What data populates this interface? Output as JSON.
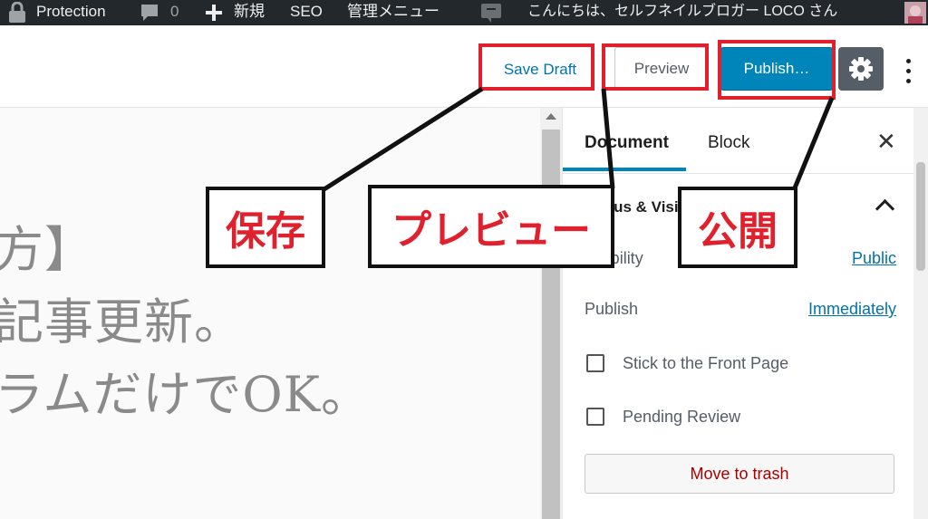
{
  "admin_bar": {
    "site_title": "Protection",
    "comments_count": "0",
    "new_label": "新規",
    "seo_label": "SEO",
    "admin_menu_label": "管理メニュー",
    "greeting": "こんにちは、セルフネイルブロガー LOCO さん"
  },
  "toolbar": {
    "save_draft": "Save Draft",
    "preview": "Preview",
    "publish": "Publish…"
  },
  "content": {
    "lines": [
      "方】",
      "記事更新。",
      "ラムだけでOK。"
    ]
  },
  "sidebar": {
    "tab_document": "Document",
    "tab_block": "Block",
    "panel_title": "Status & Visibility",
    "visibility_label": "Visibility",
    "visibility_value": "Public",
    "publish_label": "Publish",
    "publish_value": "Immediately",
    "stick_label": "Stick to the Front Page",
    "pending_label": "Pending Review",
    "trash_label": "Move to trash"
  },
  "annotations": {
    "save": "保存",
    "preview": "プレビュー",
    "publish": "公開"
  },
  "colors": {
    "accent": "#0085ba",
    "link": "#0073aa",
    "annotation_red": "#e0202c",
    "admin_bar": "#23282d"
  }
}
